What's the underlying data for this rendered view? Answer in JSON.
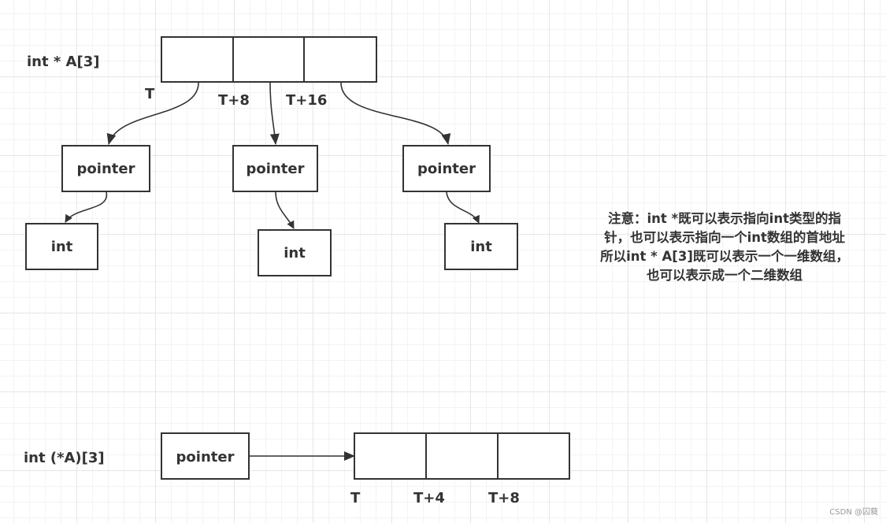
{
  "top_diagram": {
    "declaration": "int * A[3]",
    "array_cells": 3,
    "address_labels": [
      "T",
      "T+8",
      "T+16"
    ],
    "pointer_boxes": [
      "pointer",
      "pointer",
      "pointer"
    ],
    "int_boxes": [
      "int",
      "int",
      "int"
    ]
  },
  "note": {
    "lines": [
      "注意：int *既可以表示指向int类型的指",
      "针，也可以表示指向一个int数组的首地址",
      "所以int * A[3]既可以表示一个一维数组，",
      "也可以表示成一个二维数组"
    ]
  },
  "bottom_diagram": {
    "declaration": "int (*A)[3]",
    "pointer_box": "pointer",
    "array_cells": 3,
    "address_labels": [
      "T",
      "T+4",
      "T+8"
    ]
  },
  "watermark": "CSDN @囚蕤",
  "colors": {
    "stroke": "#333333",
    "grid_major": "#e6e6e6",
    "grid_minor": "#f3f3f3"
  }
}
